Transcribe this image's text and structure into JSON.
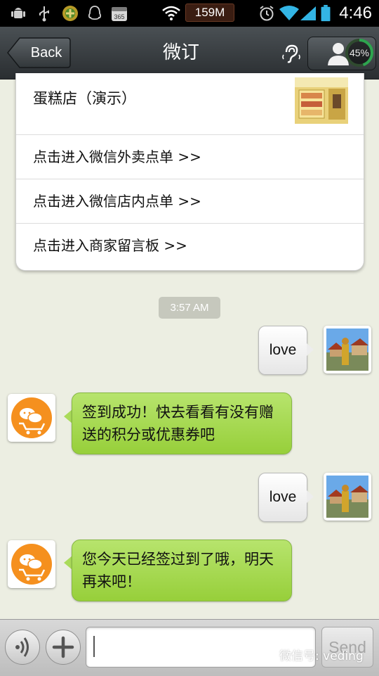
{
  "status_bar": {
    "memory_label": "159M",
    "time": "4:46",
    "icons": [
      "android-debug-icon",
      "usb-icon",
      "app-green-icon",
      "qq-icon",
      "calendar-365-icon",
      "wifi-icon",
      "alarm-icon",
      "wifi-signal-icon",
      "cell-signal-icon",
      "battery-icon"
    ]
  },
  "title_bar": {
    "back_label": "Back",
    "title": "微订",
    "profile_progress": "45%",
    "progress_value": 0.45
  },
  "article_card": {
    "title": "蛋糕店（演示）",
    "links": [
      "点击进入微信外卖点单 >>",
      "点击进入微信店内点单 >>",
      "点击进入商家留言板 >>"
    ]
  },
  "chat": {
    "timestamp": "3:57 AM",
    "messages": [
      {
        "direction": "out",
        "text": "love"
      },
      {
        "direction": "in",
        "text": "签到成功！快去看看有没有赠送的积分或优惠券吧"
      },
      {
        "direction": "out",
        "text": "love"
      },
      {
        "direction": "in",
        "text": "您今天已经签过到了哦，明天再来吧！"
      }
    ]
  },
  "input_bar": {
    "send_label": "Send",
    "input_value": ""
  },
  "watermark": {
    "text": "微信号: veding"
  },
  "colors": {
    "incoming_bubble": "#a8d953",
    "chat_background": "#eceee2",
    "title_bar": "#3a3f42",
    "shop_logo_orange": "#f5901e"
  }
}
